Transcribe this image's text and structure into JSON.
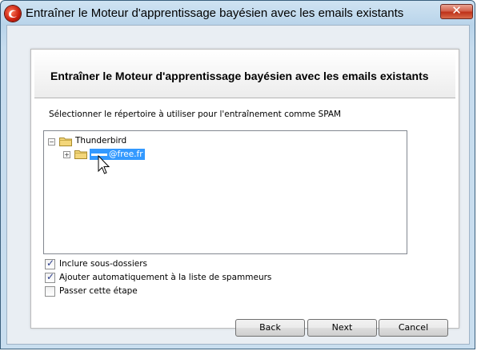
{
  "window": {
    "title": "Entraîner le Moteur d'apprentissage bayésien avec les emails existants",
    "close_label": "✕"
  },
  "panel": {
    "title": "Entraîner le Moteur d'apprentissage bayésien avec les emails existants",
    "instruction": "Sélectionner le répertoire à utiliser pour l'entraînement comme SPAM"
  },
  "tree": {
    "root": {
      "label": "Thunderbird",
      "expander": "−"
    },
    "child": {
      "label": "@free.fr",
      "expander": "+"
    }
  },
  "options": [
    {
      "label": "Inclure sous-dossiers",
      "checked": true,
      "mark": "✓"
    },
    {
      "label": "Ajouter automatiquement à la liste de spammeurs",
      "checked": true,
      "mark": "✓"
    },
    {
      "label": "Passer cette étape",
      "checked": false,
      "mark": ""
    }
  ],
  "buttons": {
    "back": "Back",
    "next": "Next",
    "cancel": "Cancel"
  },
  "colors": {
    "selection": "#3399ff",
    "close_button": "#c8341c",
    "title_bar": "#b9d4ea"
  }
}
